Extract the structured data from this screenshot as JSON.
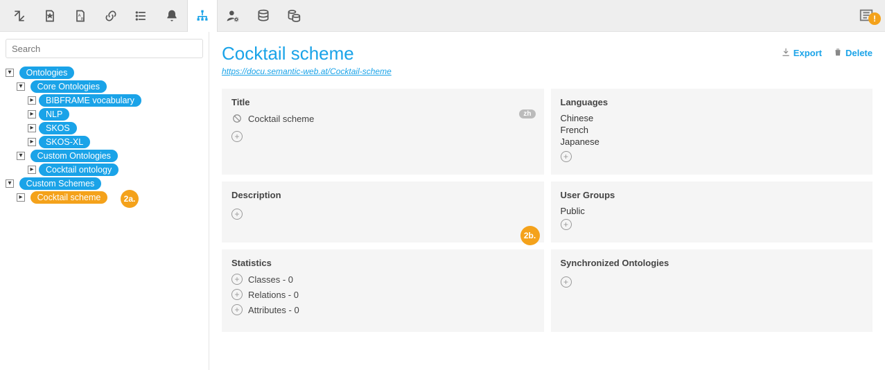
{
  "toolbar": {
    "icons": [
      "link-arrow-icon",
      "note-star-icon",
      "note-ab-icon",
      "link-icon",
      "list-icon",
      "bell-icon",
      "sitemap-icon",
      "user-gear-icon",
      "database-icon",
      "db-stack-icon"
    ],
    "activeIndex": 6,
    "warnIcon": "list-warning-icon",
    "warnBadge": "!"
  },
  "sidebar": {
    "searchPlaceholder": "Search",
    "tree": {
      "ontologies": {
        "label": "Ontologies",
        "core": {
          "label": "Core Ontologies",
          "items": [
            "BIBFRAME vocabulary",
            "NLP",
            "SKOS",
            "SKOS-XL"
          ]
        },
        "custom": {
          "label": "Custom Ontologies",
          "items": [
            "Cocktail ontology"
          ]
        }
      },
      "schemes": {
        "label": "Custom Schemes",
        "items": [
          "Cocktail scheme"
        ]
      }
    },
    "callout2a": "2a."
  },
  "header": {
    "title": "Cocktail scheme",
    "uri": "https://docu.semantic-web.at/Cocktail-scheme",
    "exportLabel": "Export",
    "deleteLabel": "Delete"
  },
  "panels": {
    "title": {
      "heading": "Title",
      "value": "Cocktail scheme",
      "langBadge": "zh"
    },
    "languages": {
      "heading": "Languages",
      "items": [
        "Chinese",
        "French",
        "Japanese"
      ]
    },
    "description": {
      "heading": "Description",
      "callout": "2b."
    },
    "userGroups": {
      "heading": "User Groups",
      "items": [
        "Public"
      ]
    },
    "statistics": {
      "heading": "Statistics",
      "classes": "Classes - 0",
      "relations": "Relations - 0",
      "attributes": "Attributes - 0"
    },
    "syncOnt": {
      "heading": "Synchronized Ontologies"
    }
  }
}
